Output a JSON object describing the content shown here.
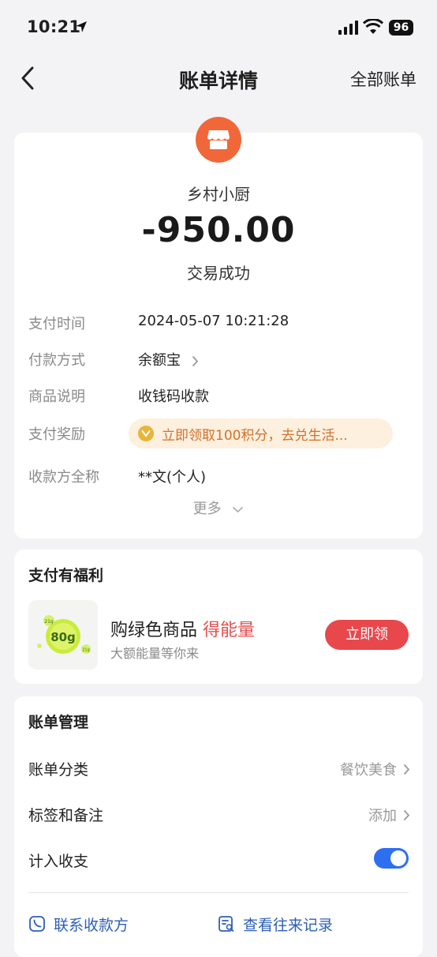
{
  "status_bar": {
    "time": "10:21",
    "battery": "96"
  },
  "nav": {
    "title": "账单详情",
    "right_label": "全部账单"
  },
  "merchant": {
    "name": "乡村小厨",
    "amount": "-950.00",
    "status": "交易成功"
  },
  "details": [
    {
      "label": "支付时间",
      "value": "2024-05-07 10:21:28"
    },
    {
      "label": "付款方式",
      "value": "余额宝"
    },
    {
      "label": "商品说明",
      "value": "收钱码收款"
    },
    {
      "label": "支付奖励",
      "value": "立即领取100积分，去兑生活..."
    },
    {
      "label": "收款方全称",
      "value": "**文(个人)"
    }
  ],
  "more_label": "更多",
  "benefit": {
    "title": "支付有福利",
    "promo_title": "购绿色商品",
    "promo_highlight": "得能量",
    "promo_sub": "大额能量等你来",
    "energy_main": "80g",
    "energy_small_1": "21g",
    "energy_small_2": "21g",
    "button_label": "立即领"
  },
  "manage": {
    "title": "账单管理",
    "category": {
      "label": "账单分类",
      "value": "餐饮美食"
    },
    "tags": {
      "label": "标签和备注",
      "value": "添加"
    },
    "include": {
      "label": "计入收支",
      "enabled": true
    }
  },
  "actions": {
    "contact": "联系收款方",
    "records": "查看往来记录"
  },
  "colors": {
    "accent_blue": "#2d6ff0",
    "reward_orange": "#d2702a",
    "claim_red": "#e8484c",
    "merchant_orange": "#f0683a"
  }
}
